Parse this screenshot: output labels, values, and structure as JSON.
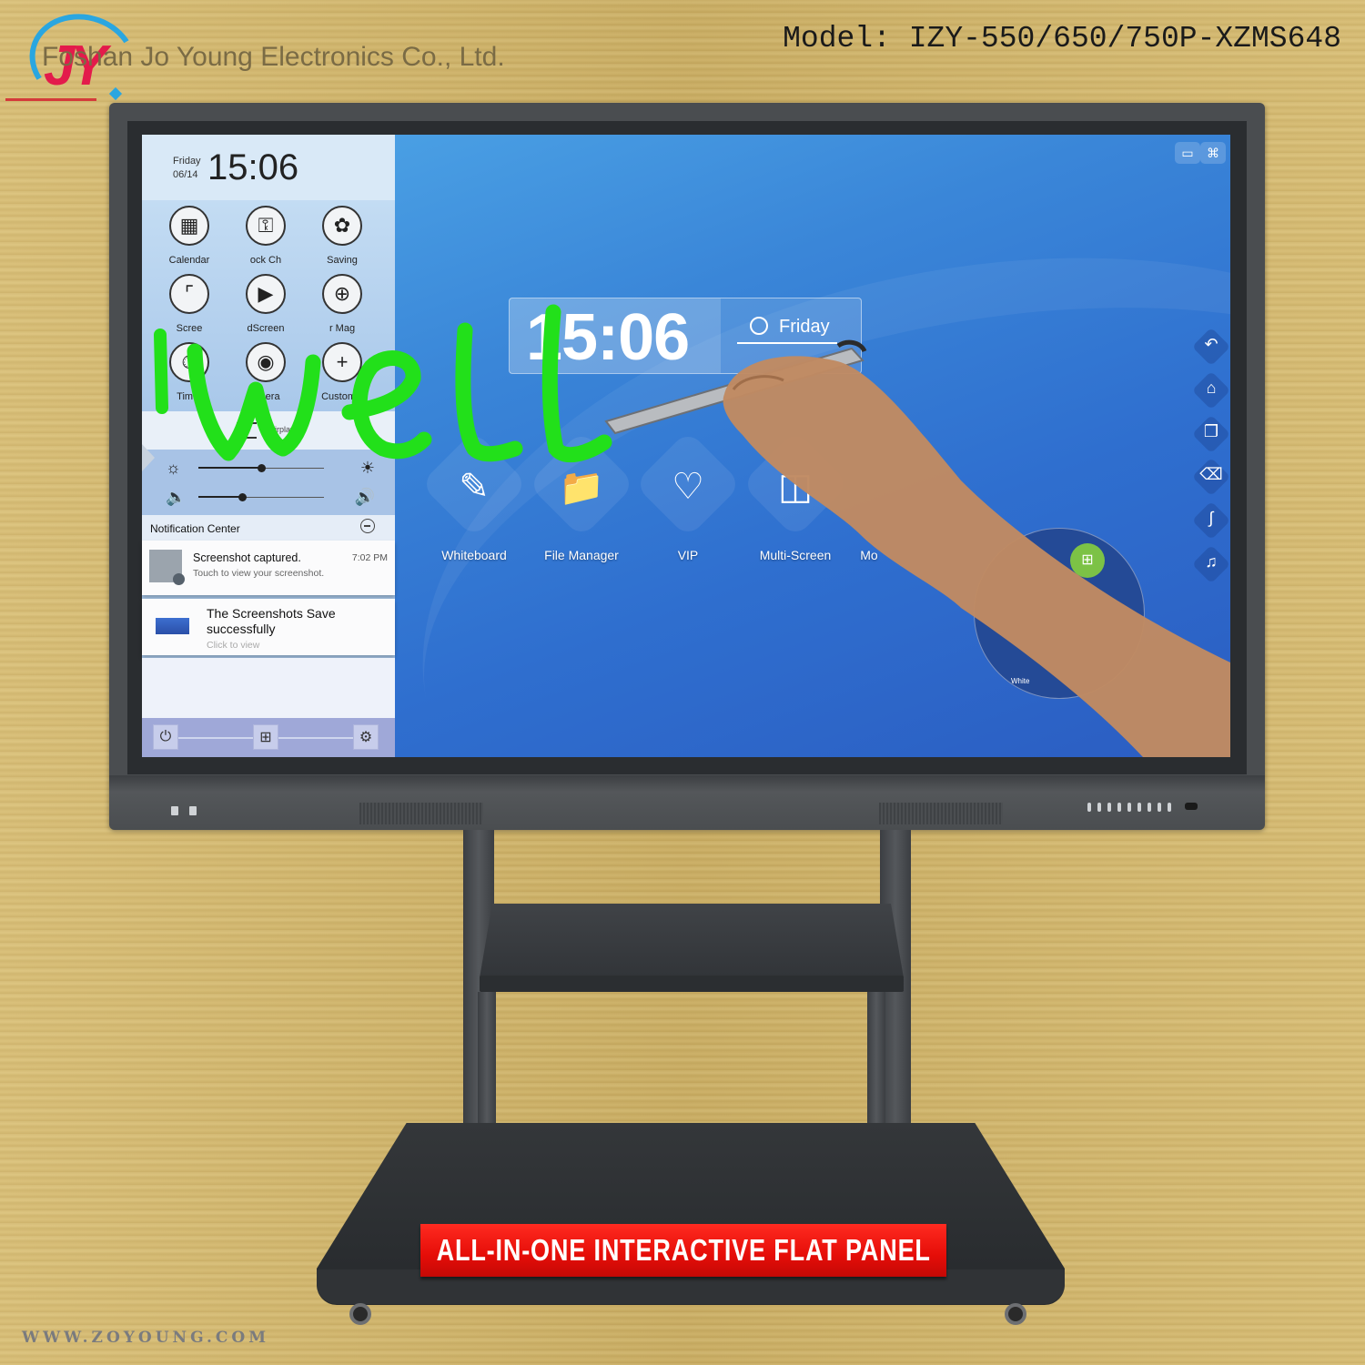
{
  "header": {
    "company_name": "Foshan Jo Young Electronics Co., Ltd.",
    "logo_text": "JY",
    "model_label": "Model: IZY-550/650/750P-XZMS648"
  },
  "colors": {
    "background_gold": "#cfb46c",
    "logo_red": "#e31b4b",
    "logo_blue": "#2aa6e0",
    "screen_blue": "#3a86d8",
    "ink_green": "#22e01a",
    "banner_red": "#e50d08"
  },
  "control_panel": {
    "date_day": "Friday",
    "date_num": "06/14",
    "time": "15:06",
    "tiles": [
      {
        "icon": "calendar-icon",
        "label": "Calendar"
      },
      {
        "icon": "unlock-icon",
        "label": "ock   Ch"
      },
      {
        "icon": "leaf-icon",
        "label": "Saving"
      },
      {
        "icon": "crop-icon",
        "label": "Scree"
      },
      {
        "icon": "video-camera-icon",
        "label": "dScreen"
      },
      {
        "icon": "zoom-in-icon",
        "label": "r    Mag"
      },
      {
        "icon": "timer-icon",
        "label": "Timer"
      },
      {
        "icon": "camera-icon",
        "label": "amera"
      },
      {
        "icon": "plus-icon",
        "label": "Customiz"
      }
    ],
    "airplay_label": "Airplay",
    "brightness_level": 0.5,
    "volume_level": 0.35,
    "notification_center_label": "Notification Center",
    "notifications": [
      {
        "title": "Screenshot captured.",
        "subtitle": "Touch to view your screenshot.",
        "time": "7:02 PM"
      },
      {
        "title": "The Screenshots Save successfully",
        "subtitle": "Click to view"
      }
    ],
    "dock": [
      {
        "icon": "power-icon"
      },
      {
        "icon": "windows-icon"
      },
      {
        "icon": "settings-gear-icon"
      }
    ]
  },
  "home_screen": {
    "clock_time": "15:06",
    "clock_day": "Friday",
    "apps": [
      {
        "label": "Whiteboard",
        "icon": "whiteboard-icon"
      },
      {
        "label": "File Manager",
        "icon": "folder-icon"
      },
      {
        "label": "VIP",
        "icon": "diamond-icon"
      },
      {
        "label": "Multi-Screen",
        "icon": "multi-screen-icon"
      },
      {
        "label": "Mo"
      }
    ],
    "floating_menu_label": "White",
    "status_icons": [
      "screen-share-icon",
      "wifi-icon"
    ],
    "side_rail": [
      "back-icon",
      "home-icon",
      "recent-apps-icon",
      "eraser-icon",
      "annotation-icon",
      "bell-icon"
    ],
    "handwriting_text": "well"
  },
  "product": {
    "banner_text": "ALL-IN-ONE INTERACTIVE FLAT PANEL",
    "website": "WWW.ZOYOUNG.COM"
  }
}
